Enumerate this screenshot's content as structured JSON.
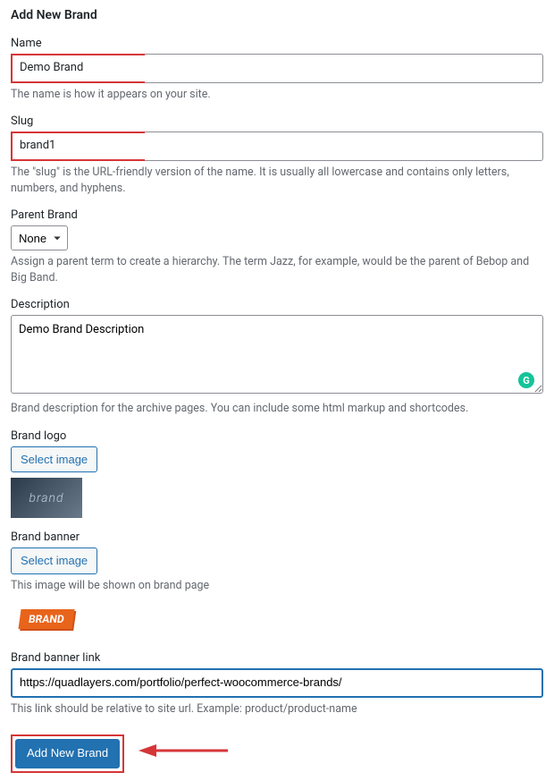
{
  "heading": "Add New Brand",
  "fields": {
    "name": {
      "label": "Name",
      "value": "Demo Brand",
      "help": "The name is how it appears on your site."
    },
    "slug": {
      "label": "Slug",
      "value": "brand1",
      "help": "The \"slug\" is the URL-friendly version of the name. It is usually all lowercase and contains only letters, numbers, and hyphens."
    },
    "parent": {
      "label": "Parent Brand",
      "selected": "None",
      "help": "Assign a parent term to create a hierarchy. The term Jazz, for example, would be the parent of Bebop and Big Band."
    },
    "description": {
      "label": "Description",
      "value": "Demo Brand Description",
      "help": "Brand description for the archive pages. You can include some html markup and shortcodes."
    },
    "logo": {
      "label": "Brand logo",
      "button": "Select image",
      "preview_text": "brand"
    },
    "banner": {
      "label": "Brand banner",
      "button": "Select image",
      "help": "This image will be shown on brand page",
      "preview_text": "BRAND"
    },
    "banner_link": {
      "label": "Brand banner link",
      "value": "https://quadlayers.com/portfolio/perfect-woocommerce-brands/",
      "help": "This link should be relative to site url. Example: product/product-name"
    }
  },
  "submit_button": "Add New Brand"
}
